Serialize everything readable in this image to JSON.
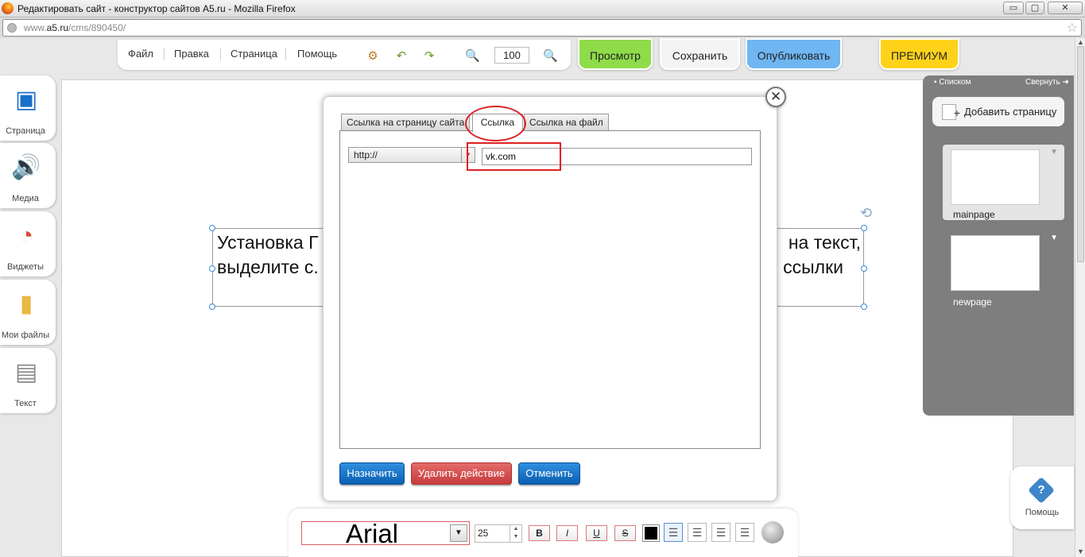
{
  "browser": {
    "window_title": "Редактировать сайт - конструктор сайтов A5.ru - Mozilla Firefox",
    "url_prefix": "www.",
    "url_domain": "a5.ru",
    "url_path": "/cms/890450/",
    "min_label": "▭",
    "max_label": "▢",
    "close_label": "✕"
  },
  "menu": {
    "items": [
      "Файл",
      "Правка",
      "Страница",
      "Помощь"
    ],
    "zoom_value": "100"
  },
  "top_buttons": {
    "preview": "Просмотр",
    "save": "Сохранить",
    "publish": "Опубликовать",
    "premium": "ПРЕМИУМ"
  },
  "sidebar": {
    "items": [
      {
        "label": "Страница",
        "icon": "page-icon"
      },
      {
        "label": "Медиа",
        "icon": "media-icon"
      },
      {
        "label": "Виджеты",
        "icon": "widgets-icon"
      },
      {
        "label": "Мои файлы",
        "icon": "folder-icon"
      },
      {
        "label": "Текст",
        "icon": "text-icon"
      }
    ]
  },
  "canvas": {
    "text_line1_left": "Установка Г",
    "text_line1_right": "на текст,",
    "text_line2_left": "выделите с.",
    "text_line2_right": "ссылки"
  },
  "pages_panel": {
    "list_label": "Списком",
    "collapse_label": "Свернуть",
    "add_page": "Добавить страницу",
    "pages": [
      {
        "name": "mainpage",
        "active": true
      },
      {
        "name": "newpage",
        "active": false
      }
    ]
  },
  "help": {
    "label": "Помощь"
  },
  "dialog": {
    "tabs": [
      "Ссылка на страницу сайта",
      "Ссылка",
      "Ссылка на файл"
    ],
    "active_tab": "Ссылка",
    "protocol": "http://",
    "url_value": "vk.com",
    "buttons": {
      "assign": "Назначить",
      "remove": "Удалить действие",
      "cancel": "Отменить"
    }
  },
  "format_bar": {
    "font": "Arial",
    "size": "25",
    "bold": "B",
    "italic": "I",
    "underline": "U",
    "strike": "S",
    "text_color": "#000000"
  },
  "colors": {
    "preview_green": "#8fdc4a",
    "publish_blue": "#6fb6f2",
    "premium_yellow": "#ffd21a",
    "dialog_blue": "#0b5fb1",
    "dialog_red": "#c63c3c",
    "highlight_red": "#dd2222"
  }
}
